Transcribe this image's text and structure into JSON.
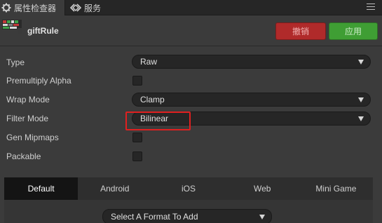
{
  "tabs": [
    {
      "label": "属性检查器",
      "icon": "gear-icon",
      "active": true
    },
    {
      "label": "服务",
      "icon": "services-icon",
      "active": false
    }
  ],
  "asset": {
    "name": "giftRule",
    "thumb_icon": "texture-thumbnail-icon"
  },
  "actions": {
    "revert_label": "撤销",
    "apply_label": "应用"
  },
  "properties": {
    "type": {
      "label": "Type",
      "value": "Raw"
    },
    "premultiply_alpha": {
      "label": "Premultiply Alpha",
      "checked": false
    },
    "wrap_mode": {
      "label": "Wrap Mode",
      "value": "Clamp"
    },
    "filter_mode": {
      "label": "Filter Mode",
      "value": "Bilinear",
      "highlighted": true
    },
    "gen_mipmaps": {
      "label": "Gen Mipmaps",
      "checked": false
    },
    "packable": {
      "label": "Packable",
      "checked": false
    }
  },
  "platforms": {
    "tabs": [
      "Default",
      "Android",
      "iOS",
      "Web",
      "Mini Game"
    ],
    "active_index": 0,
    "format_select": "Select A Format To Add"
  },
  "colors": {
    "background": "#3b3b3b",
    "revert": "#b02a2a",
    "apply": "#3f9e34",
    "highlight": "#e02020"
  }
}
